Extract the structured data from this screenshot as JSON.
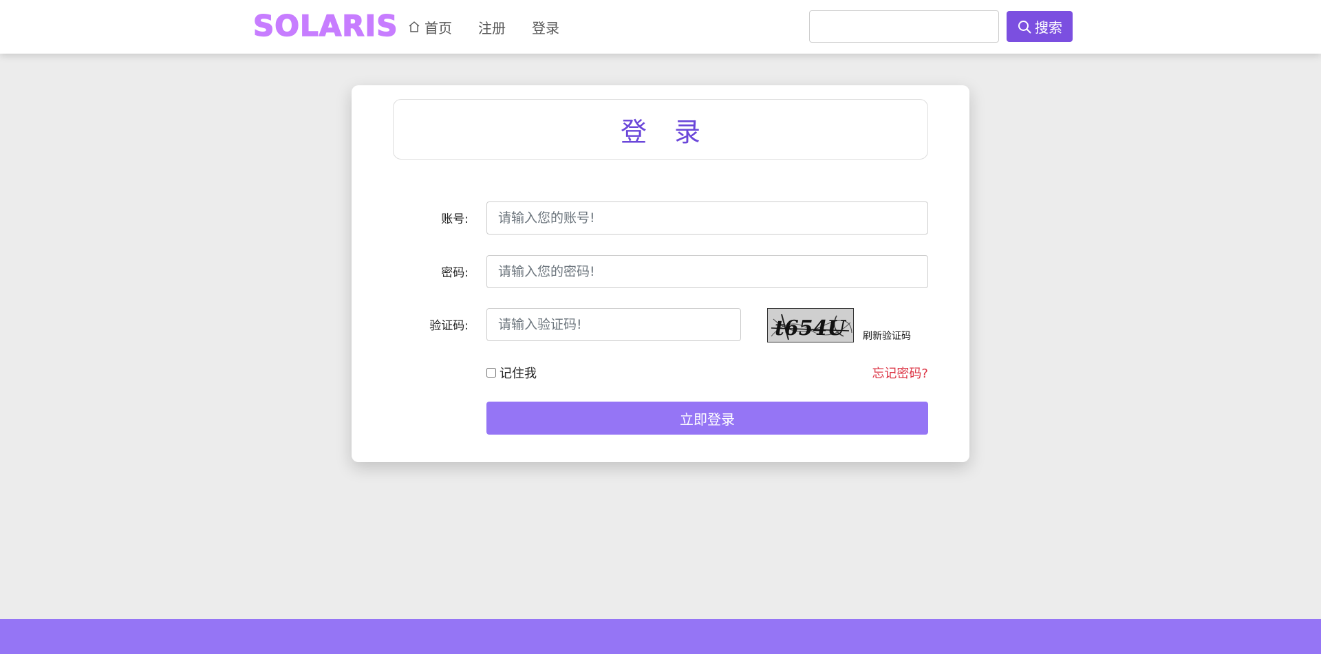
{
  "header": {
    "logo": "SOLARIS",
    "nav": [
      {
        "label": "首页",
        "icon": "home-icon"
      },
      {
        "label": "注册"
      },
      {
        "label": "登录"
      }
    ],
    "search": {
      "placeholder": "",
      "button_label": "搜索",
      "icon": "search-icon"
    }
  },
  "login": {
    "title": "登 录",
    "account_label": "账号:",
    "account_placeholder": "请输入您的账号!",
    "password_label": "密码:",
    "password_placeholder": "请输入您的密码!",
    "captcha_label": "验证码:",
    "captcha_placeholder": "请输入验证码!",
    "captcha_text": "t654U",
    "refresh_captcha": "刷新验证码",
    "remember_me": "记住我",
    "forgot_password": "忘记密码?",
    "submit": "立即登录"
  },
  "colors": {
    "brand": "#c77dff",
    "primary": "#7b4fe0",
    "button": "#9575f5",
    "danger": "#dc3545"
  }
}
